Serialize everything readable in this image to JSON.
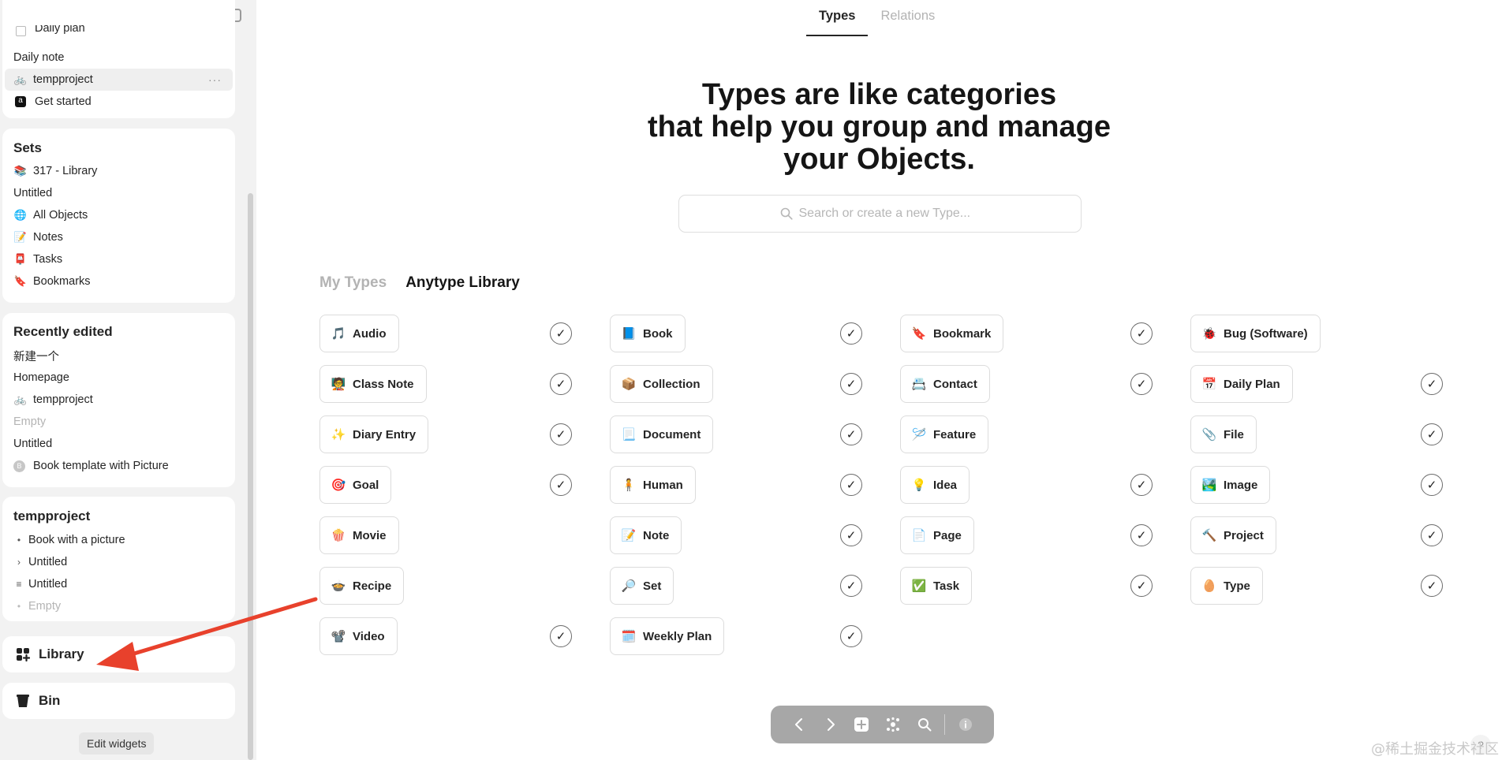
{
  "window": {
    "traffic_lights": [
      "#ff5f57",
      "#febc2e",
      "#28c840"
    ]
  },
  "sidebar": {
    "top_widget": {
      "clipped_item": "Daily plan",
      "items": [
        {
          "label": "Daily note",
          "icon": ""
        },
        {
          "label": "tempproject",
          "icon": "🚲",
          "selected": true,
          "more": "···"
        },
        {
          "label": "Get started",
          "icon": "🅰"
        }
      ]
    },
    "sets": {
      "title": "Sets",
      "items": [
        {
          "label": "317 - Library",
          "icon": "📚"
        },
        {
          "label": "Untitled",
          "icon": ""
        },
        {
          "label": "All Objects",
          "icon": "🌐"
        },
        {
          "label": "Notes",
          "icon": "📝"
        },
        {
          "label": "Tasks",
          "icon": "📮"
        },
        {
          "label": "Bookmarks",
          "icon": "🔖"
        }
      ]
    },
    "recently_edited": {
      "title": "Recently edited",
      "items": [
        {
          "label": "新建一个",
          "icon": ""
        },
        {
          "label": "Homepage",
          "icon": ""
        },
        {
          "label": "tempproject",
          "icon": "🚲"
        },
        {
          "label": "Empty",
          "icon": "",
          "muted": true
        },
        {
          "label": "Untitled",
          "icon": ""
        },
        {
          "label": "Book template with Picture",
          "icon": "B"
        }
      ]
    },
    "tempproject": {
      "title": "tempproject",
      "items": [
        {
          "label": "Book with a picture",
          "marker": "•"
        },
        {
          "label": "Untitled",
          "marker": "›"
        },
        {
          "label": "Untitled",
          "marker": "≡"
        },
        {
          "label": "Empty",
          "marker": "•",
          "muted": true
        }
      ]
    },
    "library_label": "Library",
    "bin_label": "Bin",
    "edit_widgets_label": "Edit widgets"
  },
  "main": {
    "tabs": [
      {
        "label": "Types",
        "active": true
      },
      {
        "label": "Relations",
        "active": false
      }
    ],
    "headline": [
      "Types are like categories",
      "that help you group and manage",
      "your Objects."
    ],
    "search_placeholder": "Search or create a new Type...",
    "sub_tabs": [
      {
        "label": "My Types",
        "active": false
      },
      {
        "label": "Anytype Library",
        "active": true
      }
    ],
    "columns": [
      [
        {
          "label": "Audio",
          "icon": "🎵",
          "installed": true
        },
        {
          "label": "Class Note",
          "icon": "🧑‍🏫",
          "installed": true
        },
        {
          "label": "Diary Entry",
          "icon": "✨",
          "installed": true
        },
        {
          "label": "Goal",
          "icon": "🎯",
          "installed": true
        },
        {
          "label": "Movie",
          "icon": "🍿",
          "installed": false
        },
        {
          "label": "Recipe",
          "icon": "🍲",
          "installed": false
        },
        {
          "label": "Video",
          "icon": "📽️",
          "installed": true
        }
      ],
      [
        {
          "label": "Book",
          "icon": "📘",
          "installed": true
        },
        {
          "label": "Collection",
          "icon": "📦",
          "installed": true
        },
        {
          "label": "Document",
          "icon": "📃",
          "installed": true
        },
        {
          "label": "Human",
          "icon": "🧍",
          "installed": true
        },
        {
          "label": "Note",
          "icon": "📝",
          "installed": true
        },
        {
          "label": "Set",
          "icon": "🔎",
          "installed": true
        },
        {
          "label": "Weekly Plan",
          "icon": "🗓️",
          "installed": true
        }
      ],
      [
        {
          "label": "Bookmark",
          "icon": "🔖",
          "installed": true
        },
        {
          "label": "Contact",
          "icon": "📇",
          "installed": true
        },
        {
          "label": "Feature",
          "icon": "🪡",
          "installed": false
        },
        {
          "label": "Idea",
          "icon": "💡",
          "installed": true
        },
        {
          "label": "Page",
          "icon": "📄",
          "installed": true
        },
        {
          "label": "Task",
          "icon": "✅",
          "installed": true
        }
      ],
      [
        {
          "label": "Bug (Software)",
          "icon": "🐞",
          "installed": false
        },
        {
          "label": "Daily Plan",
          "icon": "📅",
          "installed": true
        },
        {
          "label": "File",
          "icon": "📎",
          "installed": true
        },
        {
          "label": "Image",
          "icon": "🏞️",
          "installed": true
        },
        {
          "label": "Project",
          "icon": "🔨",
          "installed": true
        },
        {
          "label": "Type",
          "icon": "🥚",
          "installed": true
        }
      ]
    ],
    "check_glyph": "✓",
    "bottom_bar": [
      "back",
      "forward",
      "plus",
      "graph",
      "search",
      "info"
    ],
    "help_label": "?",
    "watermark": "@稀土掘金技术社区"
  },
  "annotation": {
    "arrow_color": "#e8412c"
  }
}
